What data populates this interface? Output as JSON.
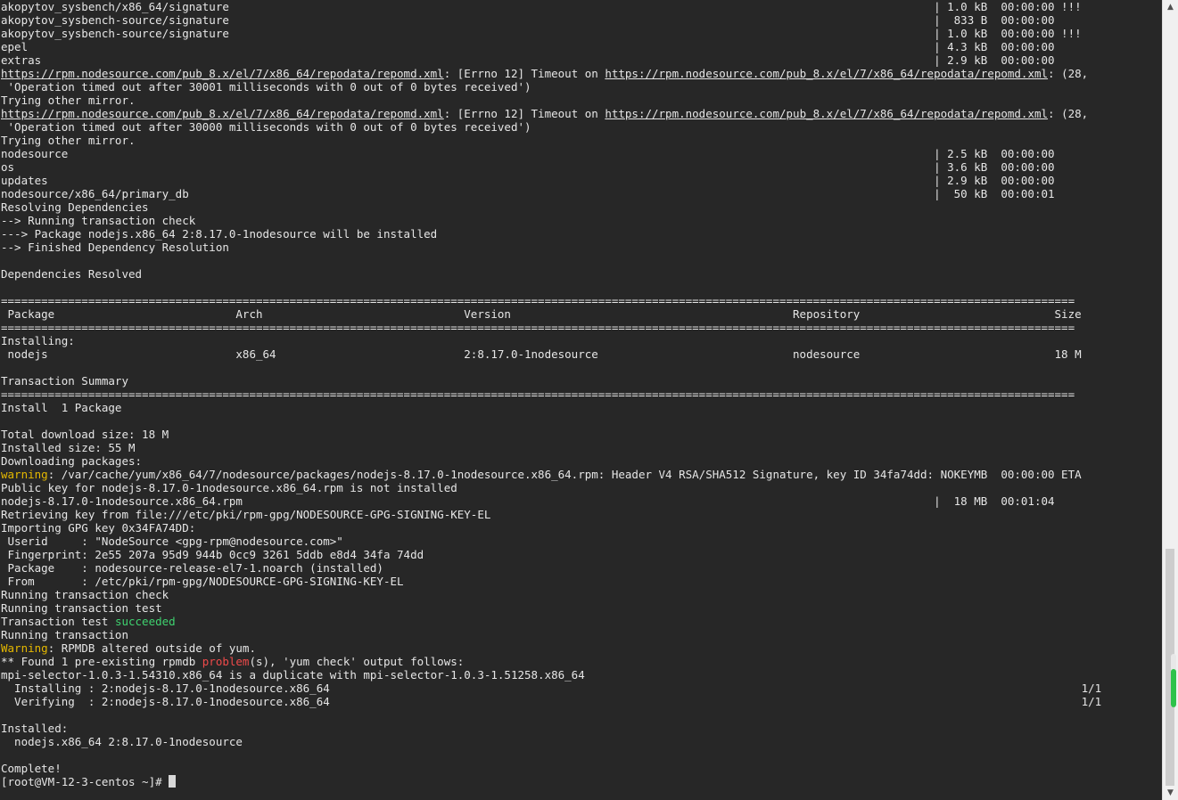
{
  "terminal": {
    "prompt": "[root@VM-12-3-centos ~]# ",
    "lines": [
      [
        {
          "t": "akopytov_sysbench/x86_64/signature                                                                                                         | 1.0 kB  00:00:00 !!!"
        }
      ],
      [
        {
          "t": "akopytov_sysbench-source/signature                                                                                                         |  833 B  00:00:00"
        }
      ],
      [
        {
          "t": "akopytov_sysbench-source/signature                                                                                                         | 1.0 kB  00:00:00 !!!"
        }
      ],
      [
        {
          "t": "epel                                                                                                                                       | 4.3 kB  00:00:00"
        }
      ],
      [
        {
          "t": "extras                                                                                                                                     | 2.9 kB  00:00:00"
        }
      ],
      [
        {
          "t": "https://rpm.nodesource.com/pub_8.x/el/7/x86_64/repodata/repomd.xml",
          "c": "u"
        },
        {
          "t": ": [Errno 12] Timeout on "
        },
        {
          "t": "https://rpm.nodesource.com/pub_8.x/el/7/x86_64/repodata/repomd.xml",
          "c": "u"
        },
        {
          "t": ": (28,"
        }
      ],
      [
        {
          "t": " 'Operation timed out after 30001 milliseconds with 0 out of 0 bytes received')"
        }
      ],
      [
        {
          "t": "Trying other mirror."
        }
      ],
      [
        {
          "t": "https://rpm.nodesource.com/pub_8.x/el/7/x86_64/repodata/repomd.xml",
          "c": "u"
        },
        {
          "t": ": [Errno 12] Timeout on "
        },
        {
          "t": "https://rpm.nodesource.com/pub_8.x/el/7/x86_64/repodata/repomd.xml",
          "c": "u"
        },
        {
          "t": ": (28,"
        }
      ],
      [
        {
          "t": " 'Operation timed out after 30000 milliseconds with 0 out of 0 bytes received')"
        }
      ],
      [
        {
          "t": "Trying other mirror."
        }
      ],
      [
        {
          "t": "nodesource                                                                                                                                 | 2.5 kB  00:00:00"
        }
      ],
      [
        {
          "t": "os                                                                                                                                         | 3.6 kB  00:00:00"
        }
      ],
      [
        {
          "t": "updates                                                                                                                                    | 2.9 kB  00:00:00"
        }
      ],
      [
        {
          "t": "nodesource/x86_64/primary_db                                                                                                               |  50 kB  00:00:01"
        }
      ],
      [
        {
          "t": "Resolving Dependencies"
        }
      ],
      [
        {
          "t": "--> Running transaction check"
        }
      ],
      [
        {
          "t": "---> Package nodejs.x86_64 2:8.17.0-1nodesource will be installed"
        }
      ],
      [
        {
          "t": "--> Finished Dependency Resolution"
        }
      ],
      [
        {
          "t": ""
        }
      ],
      [
        {
          "t": "Dependencies Resolved"
        }
      ],
      [
        {
          "t": ""
        }
      ],
      [
        {
          "t": "================================================================================================================================================================"
        }
      ],
      [
        {
          "t": " Package                           Arch                              Version                                          Repository                             Size"
        }
      ],
      [
        {
          "t": "================================================================================================================================================================"
        }
      ],
      [
        {
          "t": "Installing:"
        }
      ],
      [
        {
          "t": " nodejs                            x86_64                            2:8.17.0-1nodesource                             nodesource                             18 M"
        }
      ],
      [
        {
          "t": ""
        }
      ],
      [
        {
          "t": "Transaction Summary"
        }
      ],
      [
        {
          "t": "================================================================================================================================================================"
        }
      ],
      [
        {
          "t": "Install  1 Package"
        }
      ],
      [
        {
          "t": ""
        }
      ],
      [
        {
          "t": "Total download size: 18 M"
        }
      ],
      [
        {
          "t": "Installed size: 55 M"
        }
      ],
      [
        {
          "t": "Downloading packages:"
        }
      ],
      [
        {
          "t": "warning",
          "c": "warn"
        },
        {
          "t": ": /var/cache/yum/x86_64/7/nodesource/packages/nodejs-8.17.0-1nodesource.x86_64.rpm: Header V4 RSA/SHA512 Signature, key ID 34fa74dd: NOKEYMB  00:00:00 ETA"
        }
      ],
      [
        {
          "t": "Public key for nodejs-8.17.0-1nodesource.x86_64.rpm is not installed"
        }
      ],
      [
        {
          "t": "nodejs-8.17.0-1nodesource.x86_64.rpm                                                                                                       |  18 MB  00:01:04"
        }
      ],
      [
        {
          "t": "Retrieving key from file:///etc/pki/rpm-gpg/NODESOURCE-GPG-SIGNING-KEY-EL"
        }
      ],
      [
        {
          "t": "Importing GPG key 0x34FA74DD:"
        }
      ],
      [
        {
          "t": " Userid     : \"NodeSource <gpg-rpm@nodesource.com>\""
        }
      ],
      [
        {
          "t": " Fingerprint: 2e55 207a 95d9 944b 0cc9 3261 5ddb e8d4 34fa 74dd"
        }
      ],
      [
        {
          "t": " Package    : nodesource-release-el7-1.noarch (installed)"
        }
      ],
      [
        {
          "t": " From       : /etc/pki/rpm-gpg/NODESOURCE-GPG-SIGNING-KEY-EL"
        }
      ],
      [
        {
          "t": "Running transaction check"
        }
      ],
      [
        {
          "t": "Running transaction test"
        }
      ],
      [
        {
          "t": "Transaction test "
        },
        {
          "t": "succeeded",
          "c": "green"
        }
      ],
      [
        {
          "t": "Running transaction"
        }
      ],
      [
        {
          "t": "Warning",
          "c": "warn"
        },
        {
          "t": ": RPMDB altered outside of yum."
        }
      ],
      [
        {
          "t": "** Found 1 pre-existing rpmdb "
        },
        {
          "t": "problem",
          "c": "red"
        },
        {
          "t": "(s), 'yum check' output follows:"
        }
      ],
      [
        {
          "t": "mpi-selector-1.0.3-1.54310.x86_64 is a duplicate with mpi-selector-1.0.3-1.51258.x86_64"
        }
      ],
      [
        {
          "t": "  Installing : 2:nodejs-8.17.0-1nodesource.x86_64                                                                                                                1/1"
        }
      ],
      [
        {
          "t": "  Verifying  : 2:nodejs-8.17.0-1nodesource.x86_64                                                                                                                1/1"
        }
      ],
      [
        {
          "t": ""
        }
      ],
      [
        {
          "t": "Installed:"
        }
      ],
      [
        {
          "t": "  nodejs.x86_64 2:8.17.0-1nodesource"
        }
      ],
      [
        {
          "t": ""
        }
      ],
      [
        {
          "t": "Complete!"
        }
      ]
    ]
  },
  "scrollbar": {
    "up_icon": "▲",
    "down_icon": "▼",
    "activity_level": 0.72
  }
}
